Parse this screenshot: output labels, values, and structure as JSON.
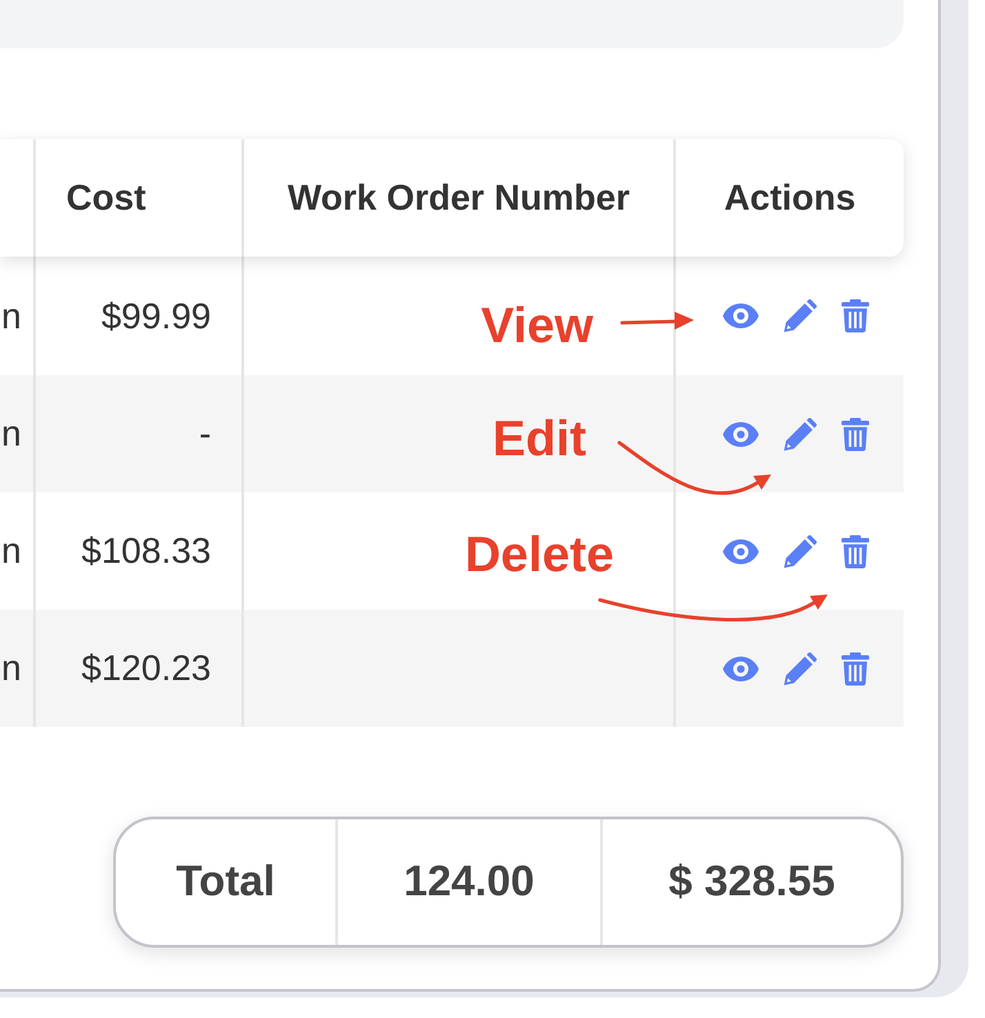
{
  "table": {
    "columns": [
      {
        "label": "Cost"
      },
      {
        "label": "Work Order Number"
      },
      {
        "label": "Actions"
      }
    ],
    "rows": [
      {
        "column_1": "n",
        "cost": "$99.99",
        "callout": {
          "label": "View",
          "kind": "view"
        }
      },
      {
        "column_1": "n",
        "cost": "-",
        "callout": {
          "label": "Edit",
          "kind": "edit"
        }
      },
      {
        "column_1": "n",
        "cost": "$108.33",
        "callout": {
          "label": "Delete",
          "kind": "delete"
        }
      },
      {
        "column_1": "n",
        "cost": "$120.23"
      }
    ]
  },
  "totals": {
    "label": "Total",
    "quantity": "124.00",
    "cost": "$ 328.55"
  }
}
